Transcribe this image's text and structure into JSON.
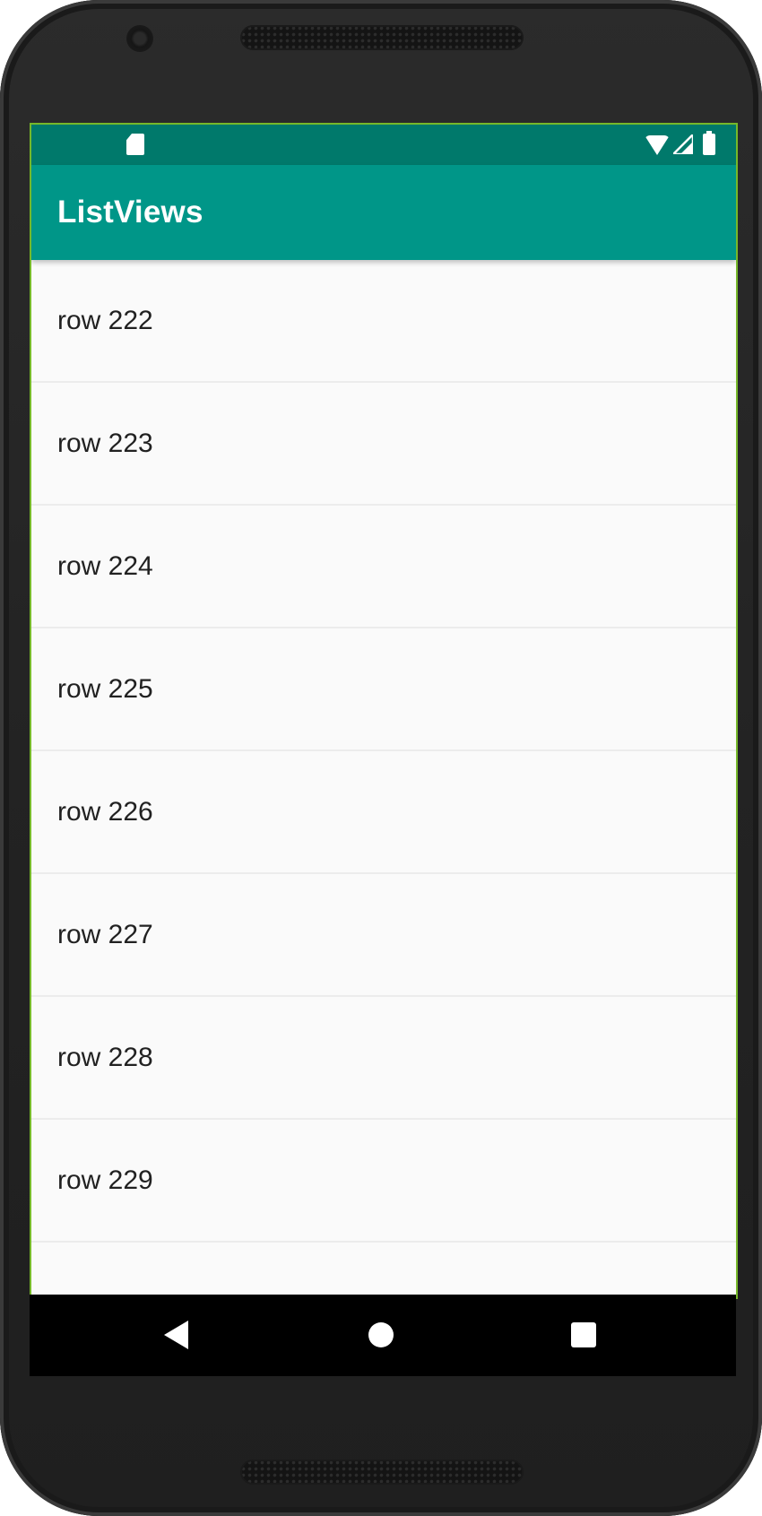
{
  "app": {
    "title": "ListViews",
    "colors": {
      "status_bar": "#00796b",
      "app_bar": "#009688",
      "list_background": "#fafafa",
      "row_text": "#212121",
      "divider": "#ececec"
    }
  },
  "status_bar": {
    "icons": [
      "sd-card-icon",
      "wifi-icon",
      "cell-signal-icon",
      "battery-icon"
    ]
  },
  "list": {
    "rows": [
      {
        "label": "row 222"
      },
      {
        "label": "row 223"
      },
      {
        "label": "row 224"
      },
      {
        "label": "row 225"
      },
      {
        "label": "row 226"
      },
      {
        "label": "row 227"
      },
      {
        "label": "row 228"
      },
      {
        "label": "row 229"
      },
      {
        "label": ""
      }
    ]
  },
  "nav_bar": {
    "icons": [
      "back-icon",
      "home-icon",
      "recents-icon"
    ]
  }
}
